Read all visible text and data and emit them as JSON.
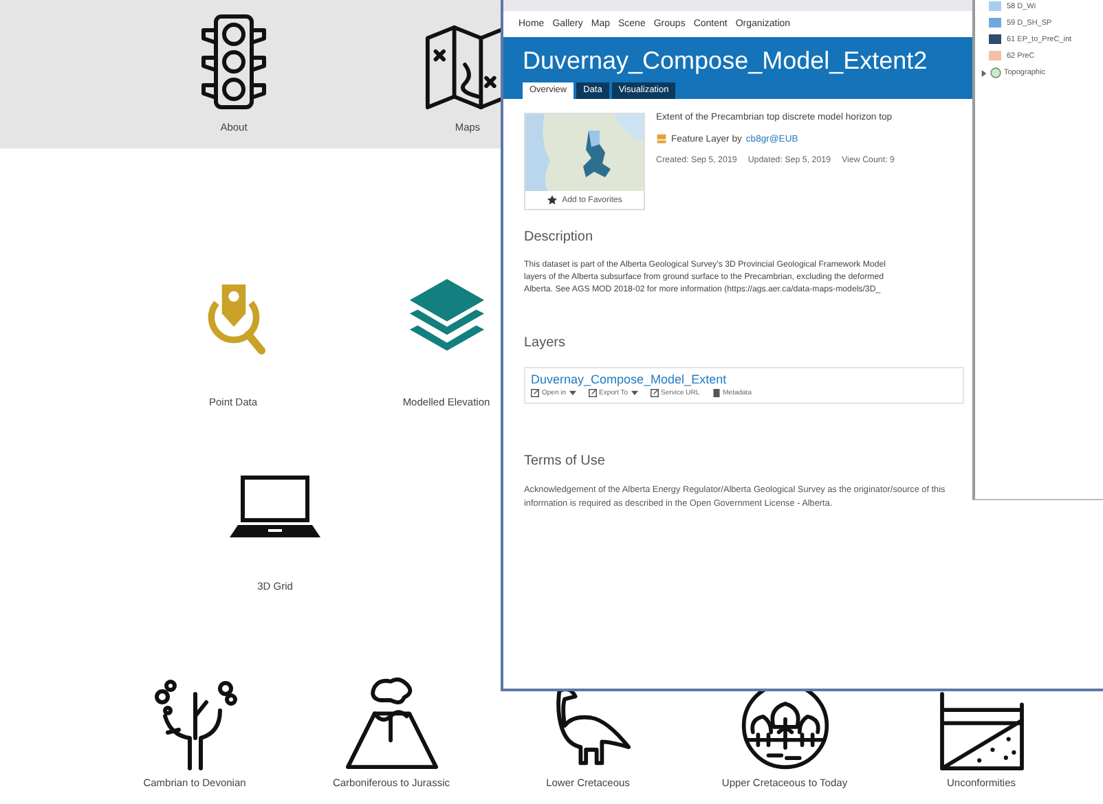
{
  "background_page": {
    "banner_tiles": [
      {
        "label": "About"
      },
      {
        "label": "Maps"
      }
    ],
    "tile_rows": [
      [
        {
          "label": "Point Data"
        },
        {
          "label": "Modelled Elevation"
        }
      ],
      [
        {
          "label": "3D Grid"
        }
      ],
      [
        {
          "label": "Cambrian to Devonian"
        },
        {
          "label": "Carboniferous to Jurassic"
        },
        {
          "label": "Lower Cretaceous"
        },
        {
          "label": "Upper Cretaceous to Today"
        },
        {
          "label": "Unconformities"
        }
      ]
    ]
  },
  "item_window": {
    "nav": [
      "Home",
      "Gallery",
      "Map",
      "Scene",
      "Groups",
      "Content",
      "Organization"
    ],
    "title": "Duvernay_Compose_Model_Extent2",
    "tabs": [
      {
        "label": "Overview",
        "selected": true
      },
      {
        "label": "Data",
        "selected": false
      },
      {
        "label": "Visualization",
        "selected": false
      }
    ],
    "favorites_button": "Add to Favorites",
    "summary": "Extent of the Precambrian top discrete model horizon top",
    "item_type": "Feature Layer by",
    "owner": "cb8gr@EUB",
    "created": "Created: Sep 5, 2019",
    "updated": "Updated: Sep 5, 2019",
    "view_count": "View Count: 9",
    "description_heading": "Description",
    "description_lines": [
      "This dataset is part of the Alberta Geological Survey's 3D Provincial Geological Framework Model",
      "layers of the Alberta subsurface from ground surface to the Precambrian, excluding the deformed",
      "Alberta. See AGS MOD 2018-02 for more information (https://ags.aer.ca/data-maps-models/3D_"
    ],
    "layers_heading": "Layers",
    "layer": {
      "name": "Duvernay_Compose_Model_Extent",
      "actions": [
        {
          "label": "Open in",
          "dropdown": true
        },
        {
          "label": "Export To",
          "dropdown": true
        },
        {
          "label": "Service URL",
          "dropdown": false
        },
        {
          "label": "Metadata",
          "dropdown": false
        }
      ]
    },
    "terms_heading": "Terms of Use",
    "terms_lines": [
      "Acknowledgement of the Alberta Energy Regulator/Alberta Geological Survey as the originator/source of this",
      "information is required as described in the Open Government License - Alberta."
    ]
  },
  "legend_window": {
    "items": [
      {
        "label": "58 D_Wi",
        "color": "#a9cdee"
      },
      {
        "label": "59 D_SH_SP",
        "color": "#6fa8dc"
      },
      {
        "label": "61 EP_to_PreC_int",
        "color": "#2e4d6b"
      },
      {
        "label": "62 PreC",
        "color": "#f5bfa5"
      }
    ],
    "group": {
      "label": "Topographic",
      "expanded": false
    }
  }
}
